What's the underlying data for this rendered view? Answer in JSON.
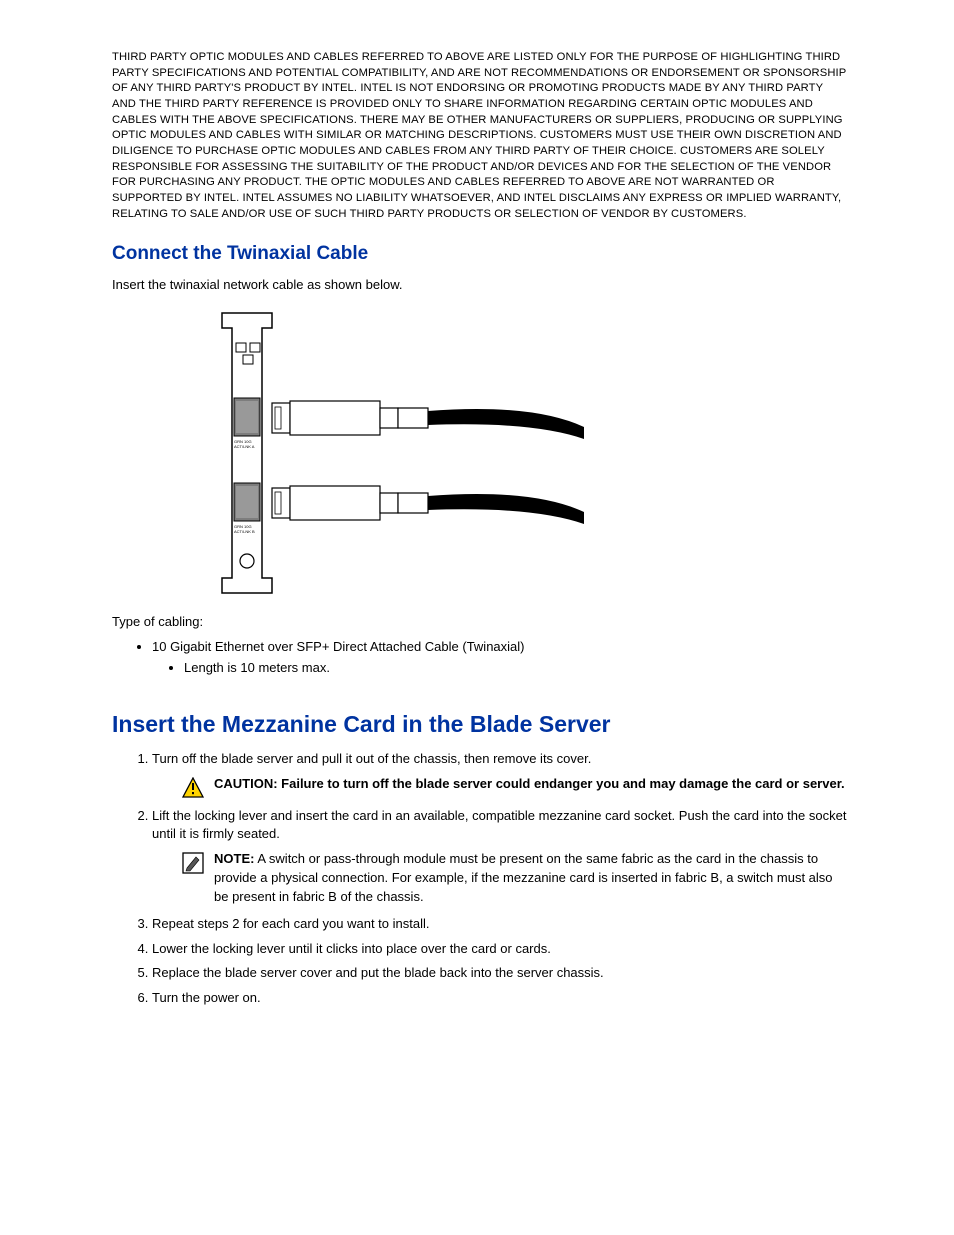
{
  "disclaimer": "THIRD PARTY OPTIC MODULES AND CABLES REFERRED TO ABOVE ARE LISTED ONLY FOR THE PURPOSE OF HIGHLIGHTING THIRD PARTY SPECIFICATIONS AND POTENTIAL COMPATIBILITY, AND ARE NOT RECOMMENDATIONS OR ENDORSEMENT OR SPONSORSHIP OF ANY THIRD PARTY'S PRODUCT BY INTEL. INTEL IS NOT ENDORSING OR PROMOTING PRODUCTS MADE BY ANY THIRD PARTY AND THE THIRD PARTY REFERENCE IS PROVIDED ONLY TO SHARE INFORMATION REGARDING CERTAIN OPTIC MODULES AND CABLES WITH THE ABOVE SPECIFICATIONS. THERE MAY BE OTHER MANUFACTURERS OR SUPPLIERS, PRODUCING OR SUPPLYING OPTIC MODULES AND CABLES WITH SIMILAR OR MATCHING DESCRIPTIONS. CUSTOMERS MUST USE THEIR OWN DISCRETION AND DILIGENCE TO PURCHASE OPTIC MODULES AND CABLES FROM ANY THIRD PARTY OF THEIR CHOICE. CUSTOMERS ARE SOLELY RESPONSIBLE FOR ASSESSING THE SUITABILITY OF THE PRODUCT AND/OR DEVICES AND FOR THE SELECTION OF THE VENDOR FOR PURCHASING ANY PRODUCT. THE OPTIC MODULES AND CABLES REFERRED TO ABOVE ARE NOT WARRANTED OR SUPPORTED BY INTEL. INTEL ASSUMES NO LIABILITY WHATSOEVER, AND INTEL DISCLAIMS ANY EXPRESS OR IMPLIED WARRANTY, RELATING TO SALE AND/OR USE OF SUCH THIRD PARTY PRODUCTS OR SELECTION OF VENDOR BY CUSTOMERS.",
  "section1": {
    "heading": "Connect the Twinaxial Cable",
    "intro": "Insert the twinaxial network cable as shown below.",
    "type_label": "Type of cabling:",
    "bullet1": "10 Gigabit Ethernet over SFP+ Direct Attached Cable (Twinaxial)",
    "bullet1_sub": "Length is 10 meters max."
  },
  "section2": {
    "heading": "Insert the Mezzanine Card in the Blade Server",
    "step1": "Turn off the blade server and pull it out of the chassis, then remove its cover.",
    "caution_label": "CAUTION:",
    "caution_text": " Failure to turn off the blade server could endanger you and may damage the card or server.",
    "step2": "Lift the locking lever and insert the card in an available, compatible mezzanine card socket. Push the card into the socket until it is firmly seated.",
    "note_label": "NOTE:",
    "note_text": " A switch or pass-through module must be present on the same fabric as the card in the chassis to provide a physical connection. For example, if the mezzanine card is inserted in fabric B, a switch must also be present in fabric B of the chassis.",
    "step3": "Repeat steps 2 for each card you want to install.",
    "step4": "Lower the locking lever until it clicks into place over the card or cards.",
    "step5": "Replace the blade server cover and put the blade back into the server chassis.",
    "step6": "Turn the power on."
  },
  "figure_labels": {
    "grn_a": "GRN 10G",
    "act_a": "ACT/LNK A",
    "grn_b": "GRN 10G",
    "act_b": "ACT/LNK B"
  }
}
